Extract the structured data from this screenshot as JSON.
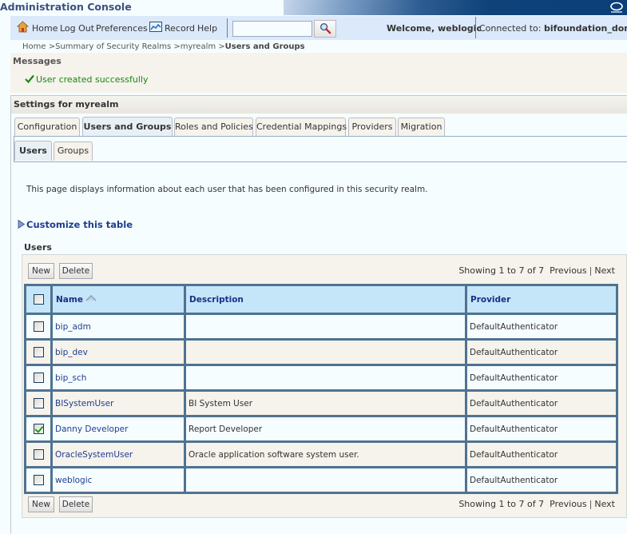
{
  "app": {
    "title": "Administration Console"
  },
  "toolbar": {
    "home": "Home",
    "logout": "Log Out",
    "preferences": "Preferences",
    "record": "Record",
    "help": "Help",
    "search_value": "",
    "welcome": "Welcome, weblogic",
    "connected_label": "Connected to: ",
    "connected_domain": "bifoundation_domai"
  },
  "breadcrumb": {
    "items": [
      "Home >",
      "Summary of Security Realms >",
      "myrealm >"
    ],
    "current": "Users and Groups"
  },
  "messages": {
    "heading": "Messages",
    "text": "User created successfully",
    "status_color": "#1c8617"
  },
  "settings": {
    "title": "Settings for myrealm",
    "tabs": [
      {
        "label": "Configuration",
        "active": false
      },
      {
        "label": "Users and Groups",
        "active": true
      },
      {
        "label": "Roles and Policies",
        "active": false
      },
      {
        "label": "Credential Mappings",
        "active": false
      },
      {
        "label": "Providers",
        "active": false
      },
      {
        "label": "Migration",
        "active": false
      }
    ],
    "subtabs": [
      {
        "label": "Users",
        "active": true
      },
      {
        "label": "Groups",
        "active": false
      }
    ],
    "description": "This page displays information about each user that has been configured in this security realm.",
    "customize_link": "Customize this table",
    "table_title": "Users"
  },
  "table": {
    "new_label": "New",
    "delete_label": "Delete",
    "paging_text": "Showing 1 to 7 of 7",
    "previous_label": "Previous",
    "next_label": "Next",
    "columns": [
      "Name",
      "Description",
      "Provider"
    ],
    "sorted_by": "Name",
    "rows": [
      {
        "name": "bip_adm",
        "description": "",
        "provider": "DefaultAuthenticator",
        "checked": false
      },
      {
        "name": "bip_dev",
        "description": "",
        "provider": "DefaultAuthenticator",
        "checked": false
      },
      {
        "name": "bip_sch",
        "description": "",
        "provider": "DefaultAuthenticator",
        "checked": false
      },
      {
        "name": "BISystemUser",
        "description": "BI System User",
        "provider": "DefaultAuthenticator",
        "checked": false
      },
      {
        "name": "Danny Developer",
        "description": "Report Developer",
        "provider": "DefaultAuthenticator",
        "checked": true
      },
      {
        "name": "OracleSystemUser",
        "description": "Oracle application software system user.",
        "provider": "DefaultAuthenticator",
        "checked": false
      },
      {
        "name": "weblogic",
        "description": "",
        "provider": "DefaultAuthenticator",
        "checked": false
      }
    ]
  }
}
